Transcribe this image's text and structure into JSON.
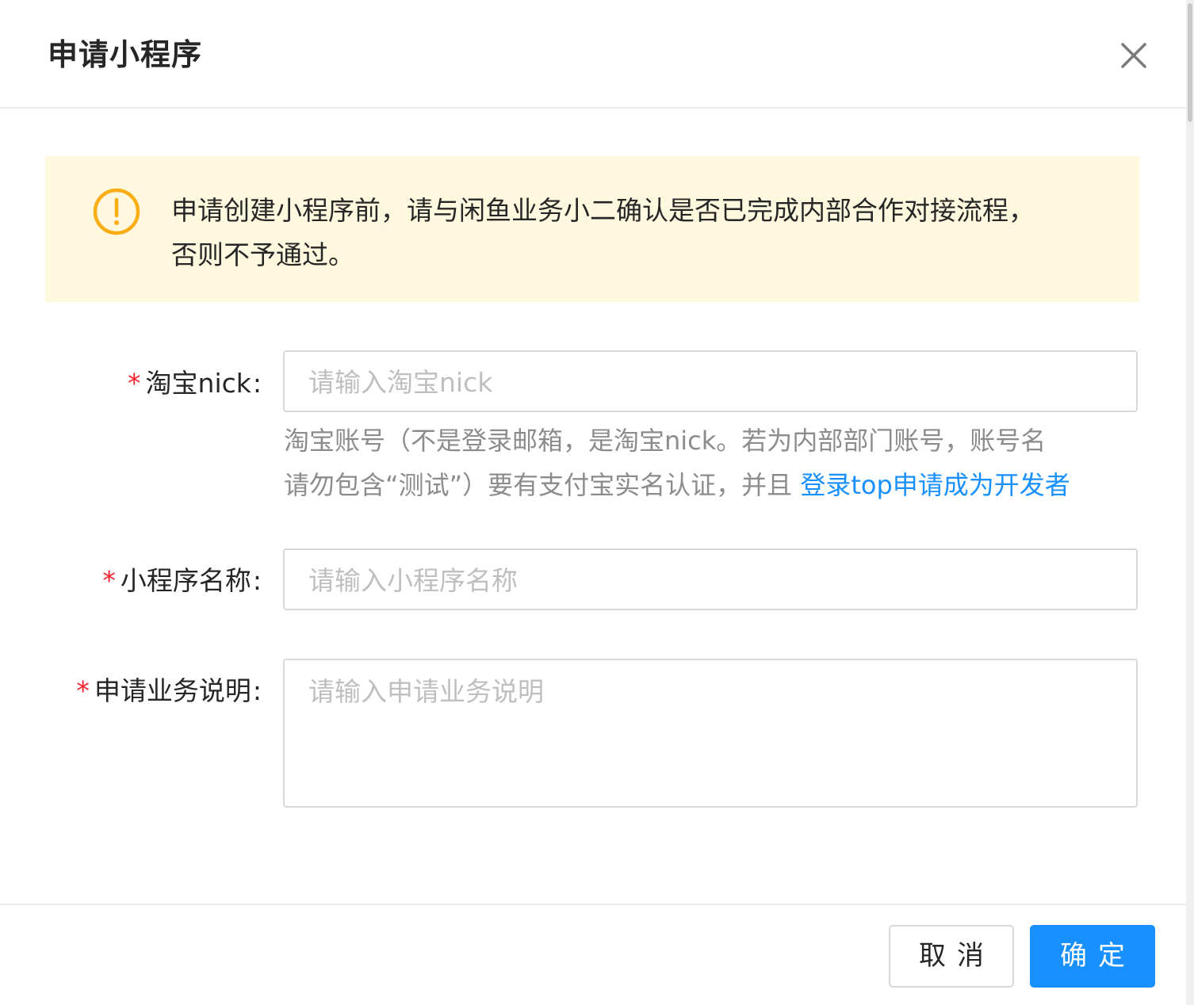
{
  "dialog": {
    "title": "申请小程序",
    "close_icon": "close-icon"
  },
  "alert": {
    "icon": "warning-circle-icon",
    "accent_color": "#faad14",
    "background_color": "#fef8df",
    "text_line1": "申请创建小程序前，请与闲鱼业务小二确认是否已完成内部合作对接流程，",
    "text_line2": "否则不予通过。"
  },
  "form": {
    "required_mark": "*",
    "colon": ":",
    "fields": [
      {
        "label": "淘宝nick",
        "placeholder": "请输入淘宝nick",
        "value": "",
        "help_line1": "淘宝账号（不是登录邮箱，是淘宝nick。若为内部部门账号，账号名",
        "help_line2": "请勿包含“测试”）要有支付宝实名认证，并且 ",
        "help_link": "登录top申请成为开发者"
      },
      {
        "label": "小程序名称",
        "placeholder": "请输入小程序名称",
        "value": ""
      },
      {
        "label": "申请业务说明",
        "placeholder": "请输入申请业务说明",
        "value": ""
      }
    ]
  },
  "footer": {
    "cancel_label": "取消",
    "ok_label": "确定",
    "primary_color": "#1890ff"
  }
}
